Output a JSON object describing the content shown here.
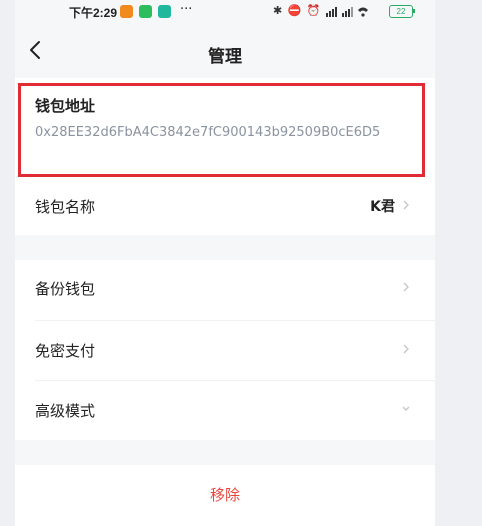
{
  "status_bar": {
    "time": "下午2:29",
    "more": "···",
    "icons_text": "✱ ⛔ ⏰",
    "battery": "22"
  },
  "nav": {
    "title": "管理"
  },
  "wallet_address": {
    "label": "钱包地址",
    "value": "0x28EE32d6FbA4C3842e7fC900143b92509B0cE6D5"
  },
  "wallet_name": {
    "label": "钱包名称",
    "value": "K君"
  },
  "settings": {
    "backup": "备份钱包",
    "password_free_pay": "免密支付",
    "advanced_mode": "高级模式"
  },
  "remove_label": "移除",
  "colors": {
    "highlight_border": "#e12b35",
    "remove_text": "#e8453c",
    "address_text": "#8a93a0"
  }
}
